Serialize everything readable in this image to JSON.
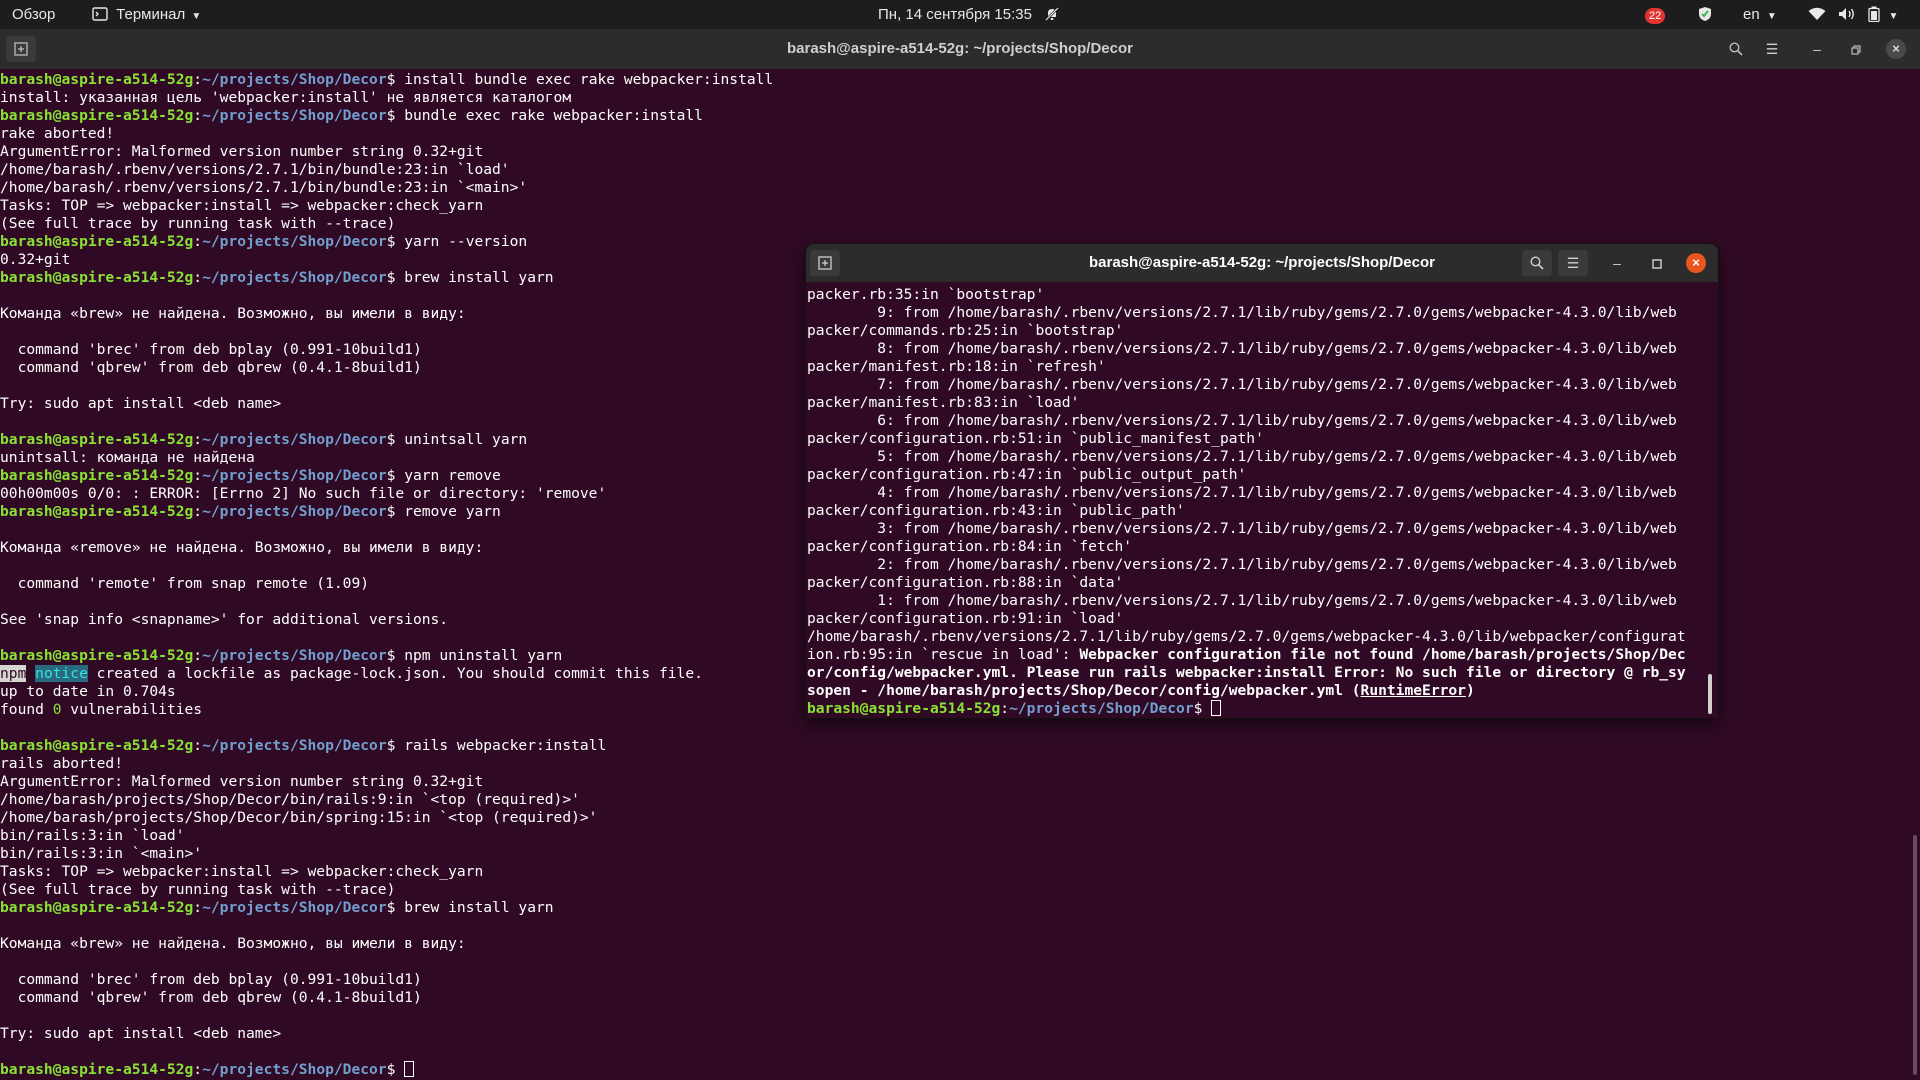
{
  "topbar": {
    "activities": "Обзор",
    "app_menu": "Терминал",
    "clock": "Пн, 14 сентября  15:35",
    "notifications": "22",
    "language": "en"
  },
  "main_window": {
    "title": "barash@aspire-a514-52g: ~/projects/Shop/Decor",
    "prompt_user": "barash@aspire-a514-52g",
    "prompt_path": "~/projects/Shop/Decor",
    "lines": [
      {
        "cmd": " install bundle exec rake webpacker:install"
      },
      {
        "text": "install: указанная цель 'webpacker:install' не является каталогом"
      },
      {
        "cmd": " bundle exec rake webpacker:install"
      },
      {
        "text": "rake aborted!"
      },
      {
        "text": "ArgumentError: Malformed version number string 0.32+git"
      },
      {
        "text": "/home/barash/.rbenv/versions/2.7.1/bin/bundle:23:in `load'"
      },
      {
        "text": "/home/barash/.rbenv/versions/2.7.1/bin/bundle:23:in `<main>'"
      },
      {
        "text": "Tasks: TOP => webpacker:install => webpacker:check_yarn"
      },
      {
        "text": "(See full trace by running task with --trace)"
      },
      {
        "cmd": " yarn --version"
      },
      {
        "text": "0.32+git"
      },
      {
        "cmd": " brew install yarn"
      },
      {
        "text": ""
      },
      {
        "text": "Команда «brew» не найдена. Возможно, вы имели в виду:"
      },
      {
        "text": ""
      },
      {
        "text": "  command 'brec' from deb bplay (0.991-10build1)"
      },
      {
        "text": "  command 'qbrew' from deb qbrew (0.4.1-8build1)"
      },
      {
        "text": ""
      },
      {
        "text": "Try: sudo apt install <deb name>"
      },
      {
        "text": ""
      },
      {
        "cmd": " unintsall yarn"
      },
      {
        "text": "unintsall: команда не найдена"
      },
      {
        "cmd": " yarn remove"
      },
      {
        "text": "00h00m00s 0/0: : ERROR: [Errno 2] No such file or directory: 'remove'"
      },
      {
        "cmd": " remove yarn"
      },
      {
        "text": ""
      },
      {
        "text": "Команда «remove» не найдена. Возможно, вы имели в виду:"
      },
      {
        "text": ""
      },
      {
        "text": "  command 'remote' from snap remote (1.09)"
      },
      {
        "text": ""
      },
      {
        "text": "See 'snap info <snapname>' for additional versions."
      },
      {
        "text": ""
      },
      {
        "cmd": " npm uninstall yarn"
      },
      {
        "npm": true,
        "npm_label": "npm",
        "npm_notice": "notice",
        "text": " created a lockfile as package-lock.json. You should commit this file."
      },
      {
        "text": "up to date in 0.704s"
      },
      {
        "found": true,
        "pre": "found ",
        "num": "0",
        "post": " vulnerabilities"
      },
      {
        "text": ""
      },
      {
        "cmd": " rails webpacker:install"
      },
      {
        "text": "rails aborted!"
      },
      {
        "text": "ArgumentError: Malformed version number string 0.32+git"
      },
      {
        "text": "/home/barash/projects/Shop/Decor/bin/rails:9:in `<top (required)>'"
      },
      {
        "text": "/home/barash/projects/Shop/Decor/bin/spring:15:in `<top (required)>'"
      },
      {
        "text": "bin/rails:3:in `load'"
      },
      {
        "text": "bin/rails:3:in `<main>'"
      },
      {
        "text": "Tasks: TOP => webpacker:install => webpacker:check_yarn"
      },
      {
        "text": "(See full trace by running task with --trace)"
      },
      {
        "cmd": " brew install yarn"
      },
      {
        "text": ""
      },
      {
        "text": "Команда «brew» не найдена. Возможно, вы имели в виду:"
      },
      {
        "text": ""
      },
      {
        "text": "  command 'brec' from deb bplay (0.991-10build1)"
      },
      {
        "text": "  command 'qbrew' from deb qbrew (0.4.1-8build1)"
      },
      {
        "text": ""
      },
      {
        "text": "Try: sudo apt install <deb name>"
      },
      {
        "text": ""
      },
      {
        "cmd": " ",
        "cursor": true
      }
    ]
  },
  "float_window": {
    "title": "barash@aspire-a514-52g: ~/projects/Shop/Decor",
    "prompt_user": "barash@aspire-a514-52g",
    "prompt_path": "~/projects/Shop/Decor",
    "lines": [
      {
        "text": "packer.rb:35:in `bootstrap'"
      },
      {
        "text": "        9: from /home/barash/.rbenv/versions/2.7.1/lib/ruby/gems/2.7.0/gems/webpacker-4.3.0/lib/web"
      },
      {
        "text": "packer/commands.rb:25:in `bootstrap'"
      },
      {
        "text": "        8: from /home/barash/.rbenv/versions/2.7.1/lib/ruby/gems/2.7.0/gems/webpacker-4.3.0/lib/web"
      },
      {
        "text": "packer/manifest.rb:18:in `refresh'"
      },
      {
        "text": "        7: from /home/barash/.rbenv/versions/2.7.1/lib/ruby/gems/2.7.0/gems/webpacker-4.3.0/lib/web"
      },
      {
        "text": "packer/manifest.rb:83:in `load'"
      },
      {
        "text": "        6: from /home/barash/.rbenv/versions/2.7.1/lib/ruby/gems/2.7.0/gems/webpacker-4.3.0/lib/web"
      },
      {
        "text": "packer/configuration.rb:51:in `public_manifest_path'"
      },
      {
        "text": "        5: from /home/barash/.rbenv/versions/2.7.1/lib/ruby/gems/2.7.0/gems/webpacker-4.3.0/lib/web"
      },
      {
        "text": "packer/configuration.rb:47:in `public_output_path'"
      },
      {
        "text": "        4: from /home/barash/.rbenv/versions/2.7.1/lib/ruby/gems/2.7.0/gems/webpacker-4.3.0/lib/web"
      },
      {
        "text": "packer/configuration.rb:43:in `public_path'"
      },
      {
        "text": "        3: from /home/barash/.rbenv/versions/2.7.1/lib/ruby/gems/2.7.0/gems/webpacker-4.3.0/lib/web"
      },
      {
        "text": "packer/configuration.rb:84:in `fetch'"
      },
      {
        "text": "        2: from /home/barash/.rbenv/versions/2.7.1/lib/ruby/gems/2.7.0/gems/webpacker-4.3.0/lib/web"
      },
      {
        "text": "packer/configuration.rb:88:in `data'"
      },
      {
        "text": "        1: from /home/barash/.rbenv/versions/2.7.1/lib/ruby/gems/2.7.0/gems/webpacker-4.3.0/lib/web"
      },
      {
        "text": "packer/configuration.rb:91:in `load'"
      },
      {
        "text": "/home/barash/.rbenv/versions/2.7.1/lib/ruby/gems/2.7.0/gems/webpacker-4.3.0/lib/webpacker/configurat"
      },
      {
        "text": "ion.rb:95:in `rescue in load': ",
        "bold": "Webpacker configuration file not found /home/barash/projects/Shop/Dec"
      },
      {
        "bold_only": "or/config/webpacker.yml. Please run rails webpacker:install Error: No such file or directory @ rb_sy"
      },
      {
        "bold_only": "sopen - /home/barash/projects/Shop/Decor/config/webpacker.yml (",
        "under": "RuntimeError",
        "tail": ")"
      },
      {
        "cmd": " ",
        "cursor": true
      }
    ]
  }
}
